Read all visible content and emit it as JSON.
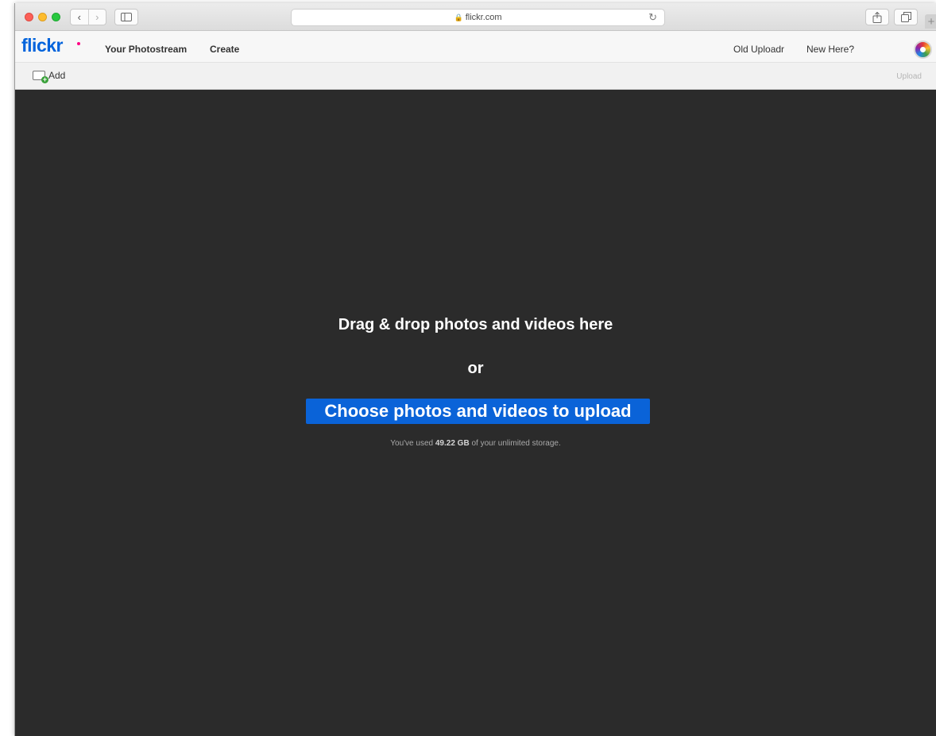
{
  "browser": {
    "url": "flickr.com",
    "new_tab": "+"
  },
  "header": {
    "logo": "flickr",
    "nav_left": [
      "Your Photostream",
      "Create"
    ],
    "nav_right": [
      "Old Uploadr",
      "New Here?"
    ]
  },
  "toolbar": {
    "add_label": "Add",
    "upload_label": "Upload"
  },
  "dropzone": {
    "title": "Drag & drop photos and videos here",
    "or": "or",
    "choose_button": "Choose photos and videos to upload",
    "storage_prefix": "You've used ",
    "storage_amount": "49.22 GB",
    "storage_suffix": " of your unlimited storage."
  },
  "colors": {
    "brand_blue": "#0063dc",
    "brand_pink": "#ff0084",
    "button_blue": "#0a63d8",
    "dropzone_bg": "#2b2b2b"
  }
}
